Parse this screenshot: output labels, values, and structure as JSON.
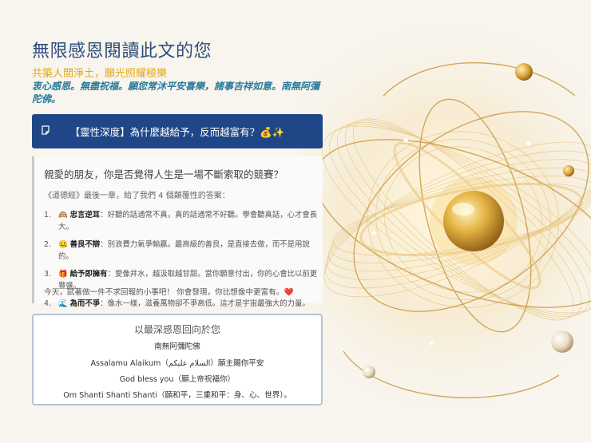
{
  "header": {
    "title": "無限感恩閱讀此文的您",
    "subtitle": "共築人間淨土，願光照耀極樂",
    "blessing": "衷心感恩。無盡祝福。願您常沐平安喜樂，諸事吉祥如意。南無阿彌陀佛。"
  },
  "banner": {
    "icon": "note-icon",
    "label": "【靈性深度】為什麼越給予，反而越富有？💰✨"
  },
  "article": {
    "question": "親愛的朋友，你是否覺得人生是一場不斷索取的競賽？",
    "intro": "《道德經》最後一章，給了我們 4 個顛覆性的答案：",
    "items": [
      {
        "num": "1.",
        "emoji": "🙉",
        "bold": "忠言逆耳",
        "text": "：好聽的話通常不真，真的話通常不好聽。學會聽真話，心才會長大。"
      },
      {
        "num": "2.",
        "emoji": "🤐",
        "bold": "善良不辯",
        "text": "：別浪費力氣爭輸贏。最高級的善良，是直接去做，而不是用說的。"
      },
      {
        "num": "3.",
        "emoji": "🎁",
        "bold": "給予即擁有",
        "text": "：愛像井水，越汲取越甘甜。當你願意付出，你的心會比以前更豐盛。"
      },
      {
        "num": "4.",
        "emoji": "🌊",
        "bold": "為而不爭",
        "text": "：像水一樣，滋養萬物卻不爭高低。這才是宇宙最強大的力量。"
      }
    ],
    "closing": "今天，試著做一件不求回報的小事吧！ 你會發現，你比想像中更富有。❤️"
  },
  "gratitude": {
    "title": "以最深感恩回向於您",
    "lines": [
      "南無阿彌陀佛",
      "Assalamu Alaikum（السلام عليكم）願主賜你平安",
      "God bless you（願上帝祝福你）",
      "Om Shanti Shanti Shanti（願和平，三重和平：身、心、世界）。"
    ]
  },
  "colors": {
    "title": "#2d4d7c",
    "subtitle": "#e3a71d",
    "blessing": "#2a7a9b",
    "banner": "#1f4788",
    "gold": "#d4a544"
  }
}
